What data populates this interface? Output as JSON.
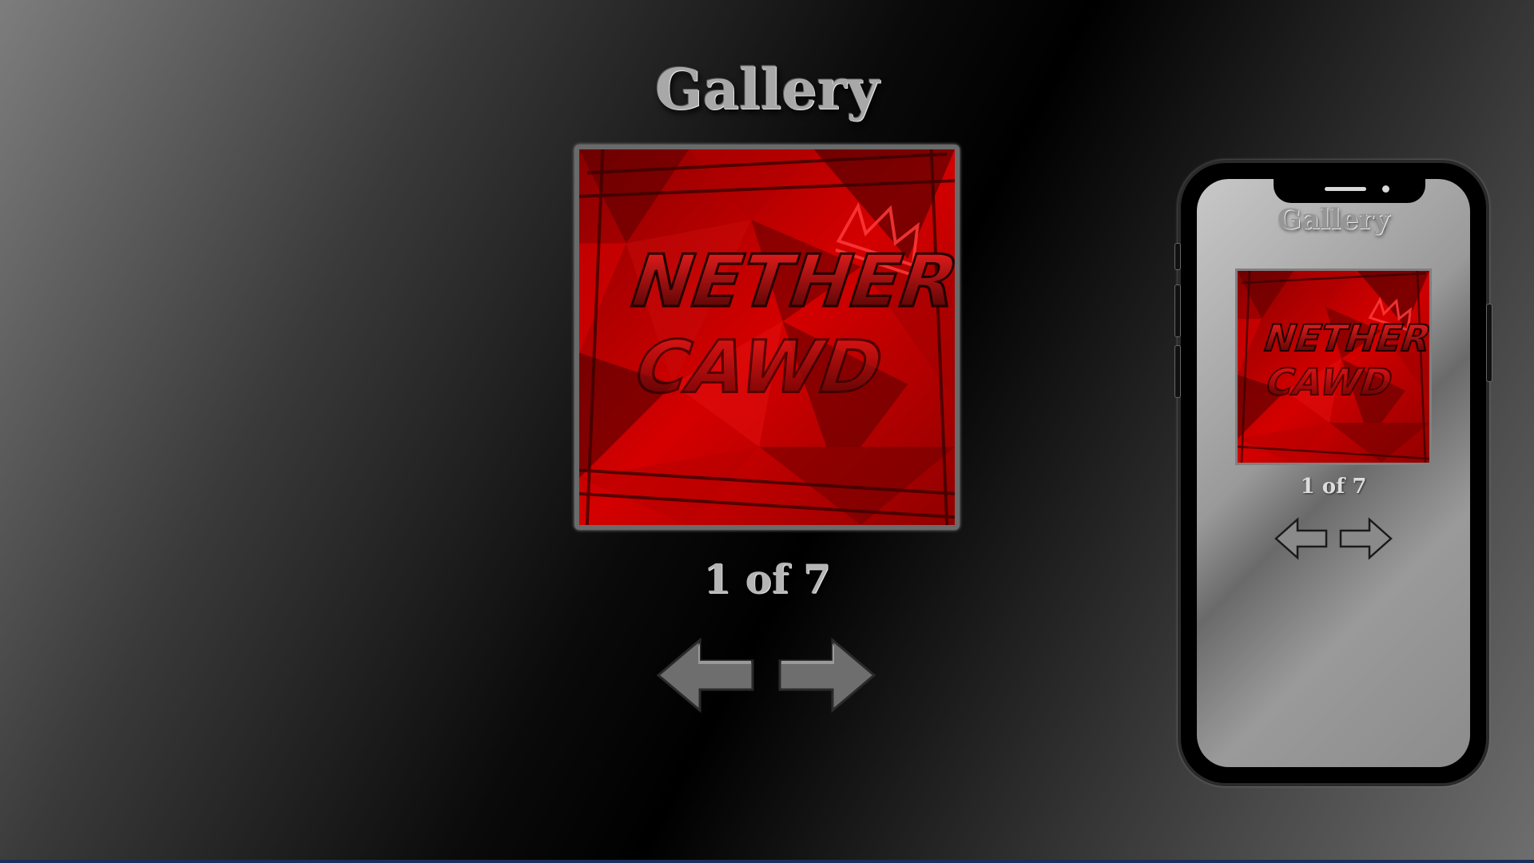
{
  "main": {
    "title": "Gallery",
    "counter": "1 of 7",
    "image": {
      "title_line_1": "NETHER",
      "title_line_2": "CAWD",
      "emblem": "crown-icon"
    },
    "prev_icon": "arrow-left-icon",
    "next_icon": "arrow-right-icon"
  },
  "phone": {
    "title": "Gallery",
    "counter": "1 of 7",
    "image": {
      "title_line_1": "NETHER",
      "title_line_2": "CAWD",
      "emblem": "crown-icon"
    },
    "prev_icon": "arrow-left-icon",
    "next_icon": "arrow-right-icon"
  },
  "colors": {
    "image_red": "#c40000",
    "image_dark_red": "#4a0000",
    "arrow_fill": "#6e6e6e",
    "phone_body": "#000000"
  }
}
